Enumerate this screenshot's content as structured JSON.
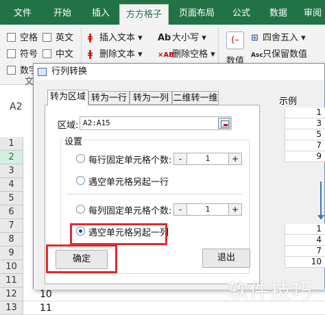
{
  "ribbon": {
    "tabs": [
      {
        "label": "文件"
      },
      {
        "label": "开始"
      },
      {
        "label": "插入"
      },
      {
        "label": "方方格子"
      },
      {
        "label": "页面布局"
      },
      {
        "label": "公式"
      },
      {
        "label": "数据"
      },
      {
        "label": "审阅"
      }
    ],
    "active_tab": "方方格子",
    "checkboxes": [
      "空格",
      "英文",
      "符号",
      "中文",
      "数字"
    ],
    "commands": [
      "插入文本",
      "删除文本",
      "大小写",
      "删除空格",
      "四舍五入",
      "只保留数值",
      "数值"
    ],
    "partial_text": "文"
  },
  "formula_bar": {
    "name_box": "A2"
  },
  "grid": {
    "rows": [
      "1",
      "2",
      "3",
      "4",
      "5",
      "6",
      "7",
      "8",
      "9",
      "10",
      "11",
      "12",
      "13"
    ],
    "selected_row": "2",
    "bottom_cells": [
      "10",
      "11"
    ]
  },
  "dialog": {
    "title": "行列转换",
    "tabs": [
      "转为区域",
      "转为一行",
      "转为一列",
      "二维转一维"
    ],
    "active_tab": "转为区域",
    "range_label": "区域:",
    "range_value": "A2:A15",
    "group_label": "设置",
    "options": [
      {
        "label": "每行固定单元格个数:",
        "checked": false,
        "value": "1"
      },
      {
        "label": "遇空单元格另起一行",
        "checked": false
      },
      {
        "label": "每列固定单元格个数:",
        "checked": false,
        "value": "1"
      },
      {
        "label": "遇空单元格另起一列",
        "checked": true
      }
    ],
    "stepper_minus": "-",
    "stepper_plus": "+",
    "ok_label": "确定",
    "exit_label": "退出"
  },
  "example": {
    "label": "示例",
    "top_values": [
      "1",
      "3",
      "5",
      "7",
      "9"
    ],
    "bottom_values": [
      "1",
      "4",
      "7",
      "10"
    ]
  },
  "watermark": "软件技巧",
  "colors": {
    "excel_green": "#217346",
    "highlight_red": "#e0282b",
    "arrow_blue": "#3b78c4"
  }
}
